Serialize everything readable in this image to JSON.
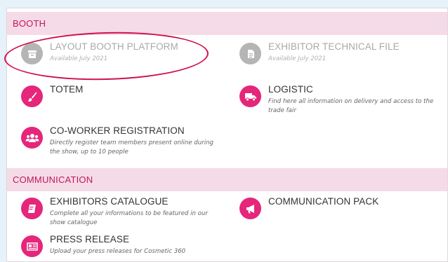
{
  "sections": [
    {
      "title": "BOOTH",
      "items": [
        {
          "title": "LAYOUT BOOTH PLATFORM",
          "desc": "Available July 2021",
          "icon": "archive-box-icon",
          "disabled": true
        },
        {
          "title": "EXHIBITOR TECHNICAL FILE",
          "desc": "Available July 2021",
          "icon": "document-icon",
          "disabled": true
        },
        {
          "title": "TOTEM",
          "desc": "",
          "icon": "paintbrush-icon",
          "disabled": false
        },
        {
          "title": "LOGISTIC",
          "desc": "Find here all information on delivery and access to the trade fair",
          "icon": "truck-icon",
          "disabled": false
        },
        {
          "title": "CO-WORKER REGISTRATION",
          "desc": "Directly register team members present online during the show, up to 10 people",
          "icon": "users-icon",
          "disabled": false
        }
      ]
    },
    {
      "title": "COMMUNICATION",
      "items": [
        {
          "title": "EXHIBITORS CATALOGUE",
          "desc": "Complete all your informations to be featured in our show catalogue",
          "icon": "catalogue-icon",
          "disabled": false
        },
        {
          "title": "COMMUNICATION PACK",
          "desc": "",
          "icon": "megaphone-icon",
          "disabled": false
        },
        {
          "title": "PRESS RELEASE",
          "desc": "Upload your press releases for Cosmetic 360",
          "icon": "newspaper-icon",
          "disabled": false
        }
      ]
    }
  ],
  "colors": {
    "accent": "#e5267a",
    "header_bg": "#f5dbe7",
    "header_text": "#c2185b",
    "disabled_icon": "#b5b5b5",
    "annotation": "#d0104f"
  }
}
